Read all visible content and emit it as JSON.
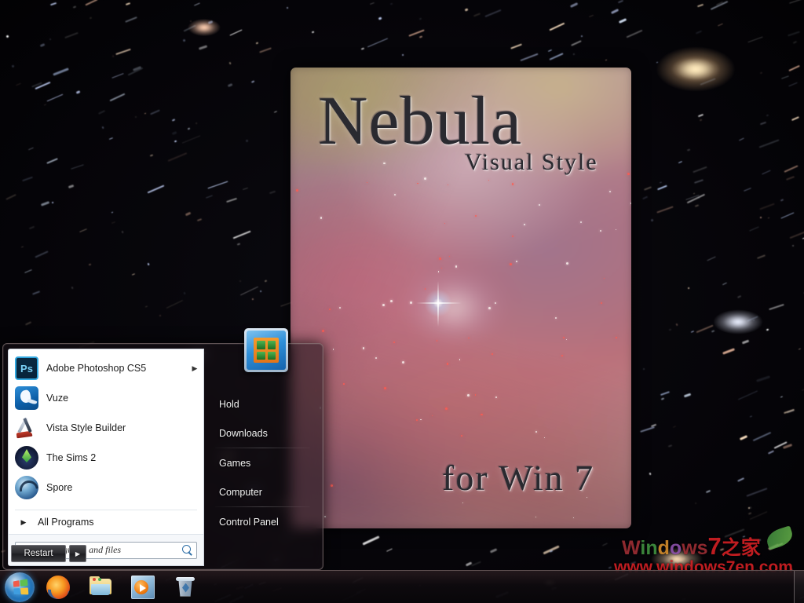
{
  "desktop": {
    "wallpaper_name": "nebula-starfield"
  },
  "wallpaper_poster": {
    "title": "Nebula",
    "subtitle": "Visual Style",
    "footer": "for Win 7"
  },
  "start_menu": {
    "programs": [
      {
        "label": "Adobe Photoshop CS5",
        "icon": "photoshop-icon",
        "has_submenu": true,
        "arrow": "▶"
      },
      {
        "label": "Vuze",
        "icon": "vuze-icon",
        "has_submenu": false,
        "arrow": ""
      },
      {
        "label": "Vista Style Builder",
        "icon": "vista-style-builder-icon",
        "has_submenu": false,
        "arrow": ""
      },
      {
        "label": "The Sims 2",
        "icon": "the-sims-2-icon",
        "has_submenu": false,
        "arrow": ""
      },
      {
        "label": "Spore",
        "icon": "spore-icon",
        "has_submenu": false,
        "arrow": ""
      }
    ],
    "all_programs": {
      "label": "All Programs",
      "arrow": "▶"
    },
    "search": {
      "placeholder": "Search programs and files",
      "value": "",
      "icon": "search-icon"
    },
    "right_items": [
      {
        "label": "Hold"
      },
      {
        "label": "Downloads"
      },
      {
        "label": "Games"
      },
      {
        "label": "Computer"
      },
      {
        "label": "Control Panel"
      }
    ],
    "power": {
      "label": "Restart",
      "arrow": "▶"
    },
    "avatar": {
      "name": "user-avatar-window-icon"
    }
  },
  "taskbar": {
    "start_button": {
      "name": "start-orb",
      "tooltip": "Start"
    },
    "pinned": [
      {
        "name": "firefox-icon",
        "label": "Mozilla Firefox"
      },
      {
        "name": "file-explorer-icon",
        "label": "Windows Explorer"
      },
      {
        "name": "media-player-icon",
        "label": "Windows Media Player"
      },
      {
        "name": "recycle-bin-icon",
        "label": "Recycle Bin"
      }
    ],
    "show_desktop": {
      "name": "show-desktop-button",
      "label": "Show desktop"
    }
  },
  "watermark": {
    "line1_parts": [
      "W",
      "i",
      "n",
      "d",
      "o",
      "w",
      "s",
      "7",
      "之家"
    ],
    "line2": "www.windows7en.com"
  },
  "colors": {
    "accent_blue": "#2f8fd8",
    "taskbar": "#0e0a0e",
    "menu_glass": "rgba(24,16,22,0.55)",
    "watermark_red": "#cf1f23",
    "nebula_pink": "#b0737f"
  }
}
